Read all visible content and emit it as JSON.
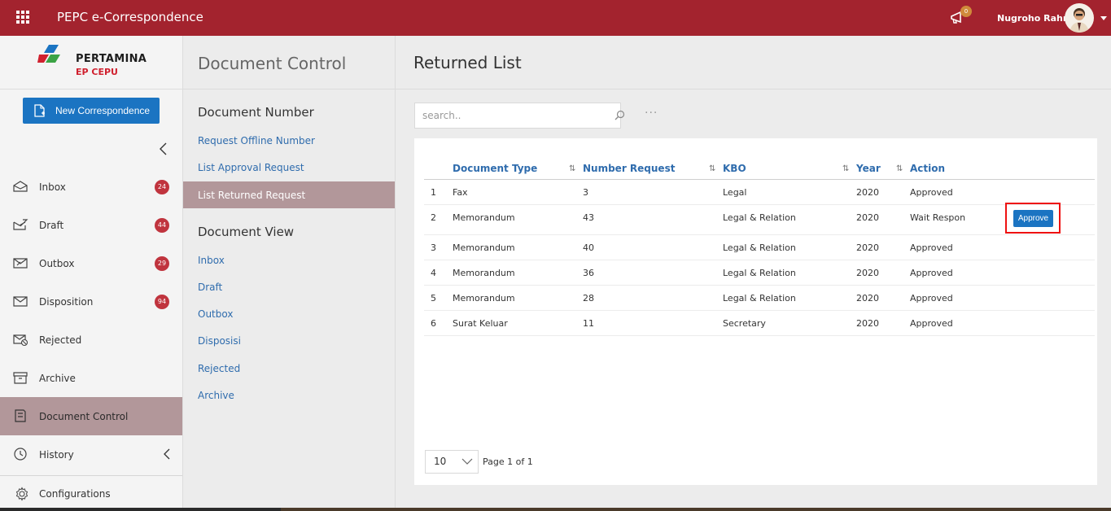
{
  "header": {
    "app_title": "PEPC e-Correspondence",
    "notification_count": "0",
    "user_name": "Nugroho Rahm"
  },
  "logo": {
    "line1": "PERTAMINA",
    "line2": "EP CEPU"
  },
  "sidebar": {
    "new_button": "New Correspondence",
    "items": [
      {
        "label": "Inbox",
        "badge": "24",
        "icon": "inbox-icon"
      },
      {
        "label": "Draft",
        "badge": "44",
        "icon": "draft-icon"
      },
      {
        "label": "Outbox",
        "badge": "29",
        "icon": "outbox-icon"
      },
      {
        "label": "Disposition",
        "badge": "94",
        "icon": "disposition-icon"
      },
      {
        "label": "Rejected",
        "badge": "",
        "icon": "rejected-icon"
      },
      {
        "label": "Archive",
        "badge": "",
        "icon": "archive-icon"
      },
      {
        "label": "Document Control",
        "badge": "",
        "icon": "document-control-icon",
        "active": true
      },
      {
        "label": "History",
        "badge": "",
        "icon": "history-icon"
      }
    ],
    "config_label": "Configurations"
  },
  "panel": {
    "title": "Document Control",
    "section1": "Document Number",
    "section1_links": [
      "Request Offline Number",
      "List Approval Request",
      "List Returned Request"
    ],
    "section2": "Document View",
    "section2_links": [
      "Inbox",
      "Draft",
      "Outbox",
      "Disposisi",
      "Rejected",
      "Archive"
    ]
  },
  "main": {
    "title": "Returned List",
    "search_placeholder": "search..",
    "more": "···",
    "columns": [
      "Document Type",
      "Number Request",
      "KBO",
      "Year",
      "Action"
    ],
    "rows": [
      {
        "no": "1",
        "type": "Fax",
        "number": "3",
        "kbo": "Legal",
        "year": "2020",
        "action": "Approved"
      },
      {
        "no": "2",
        "type": "Memorandum",
        "number": "43",
        "kbo": "Legal & Relation",
        "year": "2020",
        "action": "Wait Respon"
      },
      {
        "no": "3",
        "type": "Memorandum",
        "number": "40",
        "kbo": "Legal & Relation",
        "year": "2020",
        "action": "Approved"
      },
      {
        "no": "4",
        "type": "Memorandum",
        "number": "36",
        "kbo": "Legal & Relation",
        "year": "2020",
        "action": "Approved"
      },
      {
        "no": "5",
        "type": "Memorandum",
        "number": "28",
        "kbo": "Legal & Relation",
        "year": "2020",
        "action": "Approved"
      },
      {
        "no": "6",
        "type": "Surat Keluar",
        "number": "11",
        "kbo": "Secretary",
        "year": "2020",
        "action": "Approved"
      }
    ],
    "approve_button": "Approve",
    "page_size": "10",
    "page_text": "Page 1 of 1"
  },
  "colors": {
    "brand_red": "#a3232e",
    "primary_blue": "#1b74c2",
    "active_bg": "#b2979a",
    "badge_red": "#c0343e",
    "highlight_frame": "#ee1111"
  }
}
